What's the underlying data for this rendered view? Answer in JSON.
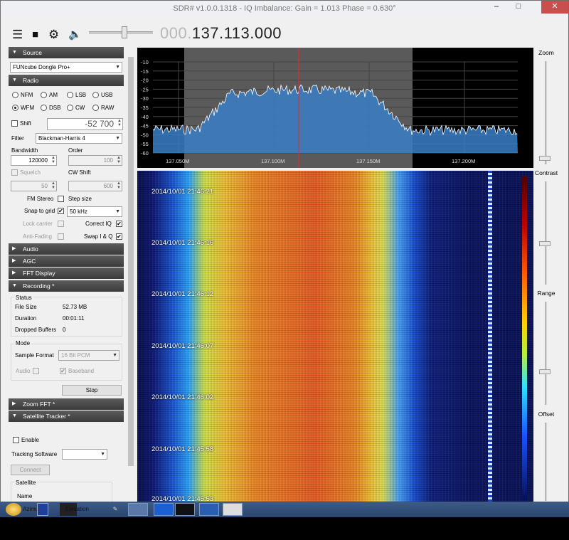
{
  "window": {
    "title": "SDR# v1.0.0.1318 - IQ Imbalance: Gain = 1.013 Phase = 0.630°",
    "minimize_glyph": "–",
    "maximize_glyph": "□",
    "close_glyph": "✕"
  },
  "toolbar": {
    "menu_icon": "☰",
    "stop_icon": "■",
    "settings_icon": "⚙",
    "volume_icon": "🔈",
    "freq_prefix": "000.",
    "freq_main": "137.113.000"
  },
  "source": {
    "header": "Source",
    "device": "FUNcube Dongle Pro+"
  },
  "radio": {
    "header": "Radio",
    "modes": [
      {
        "label": "NFM",
        "selected": false
      },
      {
        "label": "AM",
        "selected": false
      },
      {
        "label": "LSB",
        "selected": false
      },
      {
        "label": "USB",
        "selected": false
      },
      {
        "label": "WFM",
        "selected": true
      },
      {
        "label": "DSB",
        "selected": false
      },
      {
        "label": "CW",
        "selected": false
      },
      {
        "label": "RAW",
        "selected": false
      }
    ],
    "shift_label": "Shift",
    "shift_value": "-52 700",
    "filter_label": "Filter",
    "filter_value": "Blackman-Harris 4",
    "bandwidth_label": "Bandwidth",
    "bandwidth_value": "120000",
    "order_label": "Order",
    "order_value": "100",
    "squelch_label": "Squelch",
    "squelch_value": "50",
    "cwshift_label": "CW Shift",
    "cwshift_value": "600",
    "fmstereo_label": "FM Stereo",
    "stepsize_label": "Step size",
    "snap_label": "Snap to grid",
    "step_value": "50 kHz",
    "lock_label": "Lock carrier",
    "correctiq_label": "Correct IQ",
    "antifading_label": "Anti-Fading",
    "swapiq_label": "Swap I & Q"
  },
  "collapsed_sections": [
    "Audio",
    "AGC",
    "FFT Display"
  ],
  "recording": {
    "header": "Recording *",
    "status_label": "Status",
    "filesize_label": "File Size",
    "filesize_value": "52.73 MB",
    "duration_label": "Duration",
    "duration_value": "00:01:11",
    "dropped_label": "Dropped Buffers",
    "dropped_value": "0",
    "mode_label": "Mode",
    "sampleformat_label": "Sample Format",
    "sampleformat_value": "16 Bit PCM",
    "audio_label": "Audio",
    "baseband_label": "Baseband",
    "stop_label": "Stop"
  },
  "zoomfft": {
    "header": "Zoom FFT *"
  },
  "satellite": {
    "header": "Satellite Tracker *",
    "enable_label": "Enable",
    "tracking_label": "Tracking Software",
    "connect_label": "Connect",
    "satellite_label": "Satellite",
    "name_label": "Name"
  },
  "spectrum": {
    "db_ticks": [
      "-10",
      "-15",
      "-20",
      "-25",
      "-30",
      "-35",
      "-40",
      "-45",
      "-50",
      "-55",
      "-60"
    ],
    "freq_ticks": [
      "137.050M",
      "137.100M",
      "137.150M",
      "137.200M"
    ]
  },
  "waterfall": {
    "timestamps": [
      "2014/10/01 21:46:21",
      "2014/10/01 21:46:16",
      "2014/10/01 21:46:12",
      "2014/10/01 21:46:07",
      "2014/10/01 21:46:02",
      "2014/10/01 21:45:58",
      "2014/10/01 21:45:53"
    ]
  },
  "right_panel": {
    "zoom_label": "Zoom",
    "contrast_label": "Contrast",
    "range_label": "Range",
    "offset_label": "Offset"
  },
  "taskbar": {
    "items": [
      "Azimuth",
      "Elevation"
    ]
  },
  "colors": {
    "header_bg": "#3a3a3a",
    "center_marker": "#ff2020",
    "passband": "#5a5a5a",
    "spectrum_fill": "#3a7fc7"
  }
}
